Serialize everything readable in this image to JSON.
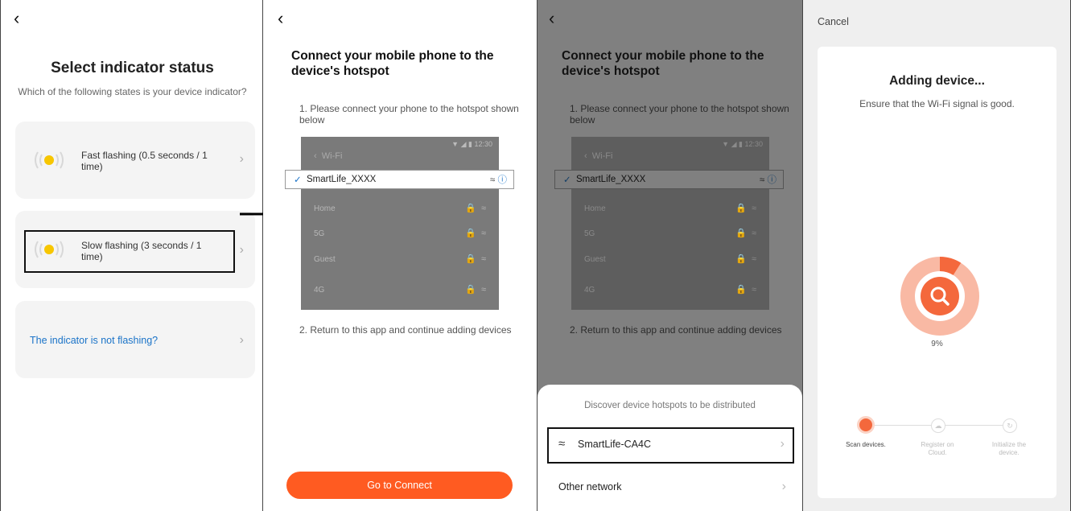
{
  "panel1": {
    "back_icon": "chevron-left-icon",
    "title": "Select indicator status",
    "subtitle": "Which of the following states is your device indicator?",
    "options": [
      {
        "label": "Fast flashing (0.5 seconds / 1 time)"
      },
      {
        "label": "Slow flashing (3 seconds / 1 time)"
      }
    ],
    "not_flashing": "The indicator is not flashing?",
    "accent": "#1a73c8",
    "indicator_color": "#f7c600"
  },
  "panel2": {
    "title": "Connect your mobile phone to the device's hotspot",
    "step1": "1. Please connect your phone to the hotspot shown below",
    "step2": "2. Return to this app and continue adding devices",
    "wifi": {
      "status_time": "12:30",
      "header": "Wi-Fi",
      "selected": "SmartLife_XXXX",
      "networks": [
        "Home",
        "5G",
        "Guest",
        "4G"
      ]
    },
    "button": "Go to Connect",
    "button_color": "#ff5b21"
  },
  "panel3": {
    "title": "Connect your mobile phone to the device's hotspot",
    "step1": "1. Please connect your phone to the hotspot shown below",
    "step2": "2. Return to this app and continue adding devices",
    "wifi": {
      "status_time": "12:30",
      "header": "Wi-Fi",
      "selected": "SmartLife_XXXX",
      "networks": [
        "Home",
        "5G",
        "Guest",
        "4G"
      ]
    },
    "sheet_title": "Discover device hotspots to be distributed",
    "hotspot": "SmartLife-CA4C",
    "other": "Other network"
  },
  "panel4": {
    "cancel": "Cancel",
    "title": "Adding device...",
    "subtitle": "Ensure that the Wi-Fi signal is good.",
    "progress_percent": 9,
    "progress_label": "9%",
    "steps": [
      "Scan devices.",
      "Register on Cloud.",
      "Initialize the device."
    ],
    "accent": "#f4683c"
  }
}
